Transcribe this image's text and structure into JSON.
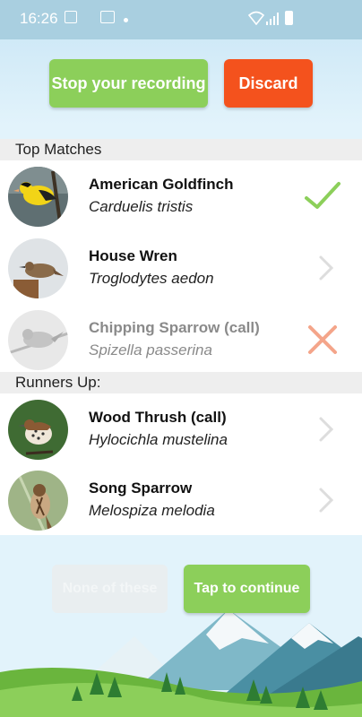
{
  "status_bar": {
    "time": "16:26"
  },
  "top_buttons": {
    "stop_label": "Stop your recording",
    "discard_label": "Discard"
  },
  "sections": {
    "top_matches": "Top Matches",
    "runners_up": "Runners Up:"
  },
  "top_matches": [
    {
      "name": "American Goldfinch",
      "scientific": "Carduelis tristis",
      "status": "confirmed",
      "status_icon": "check-icon"
    },
    {
      "name": "House Wren",
      "scientific": "Troglodytes aedon",
      "status": "pending",
      "status_icon": "chevron-right-icon"
    },
    {
      "name": "Chipping Sparrow (call)",
      "scientific": "Spizella passerina",
      "status": "rejected",
      "status_icon": "close-icon"
    }
  ],
  "runners_up": [
    {
      "name": "Wood Thrush (call)",
      "scientific": "Hylocichla mustelina",
      "status_icon": "chevron-right-icon"
    },
    {
      "name": "Song Sparrow",
      "scientific": "Melospiza melodia",
      "status_icon": "chevron-right-icon"
    }
  ],
  "bottom_buttons": {
    "none_label": "None of these",
    "continue_label": "Tap to continue"
  },
  "colors": {
    "accent_green": "#8ccf5a",
    "discard_orange": "#f4521d",
    "check_green": "#8ccf5a",
    "reject_salmon": "#f4a58a",
    "chevron_gray": "#dddddd"
  }
}
